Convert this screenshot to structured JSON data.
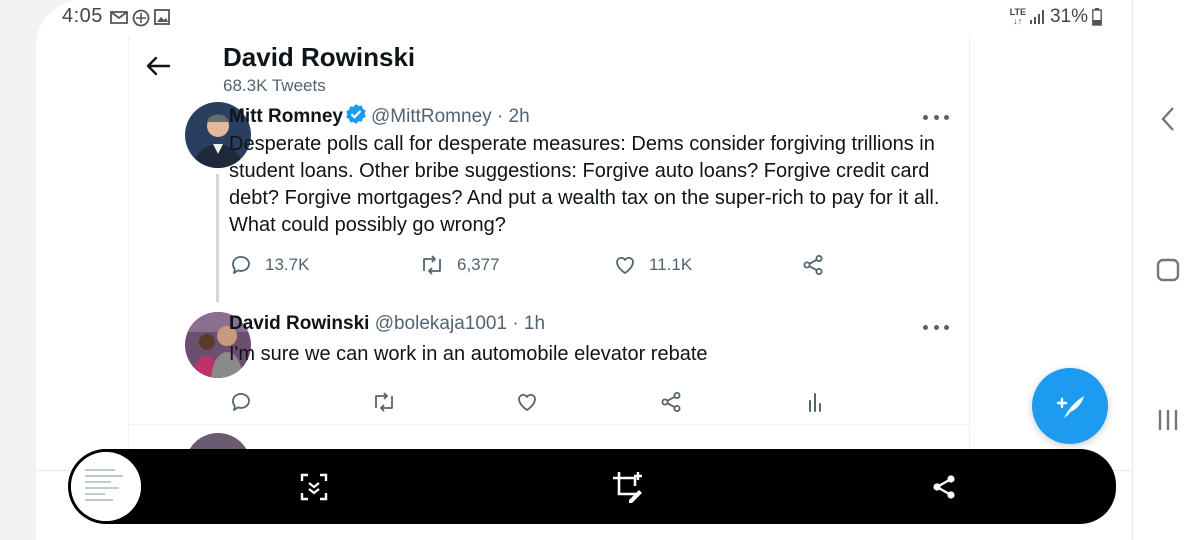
{
  "status_bar": {
    "time": "4:05",
    "network": "LTE",
    "battery": "31%"
  },
  "header": {
    "title": "David Rowinski",
    "subtitle": "68.3K Tweets"
  },
  "tweets": [
    {
      "name": "Mitt Romney",
      "handle": "@MittRomney",
      "time": "· 2h",
      "verified": true,
      "text": "Desperate polls call for desperate measures: Dems consider forgiving trillions in student loans. Other bribe suggestions: Forgive auto loans? Forgive credit card debt? Forgive mortgages? And put a wealth tax on the super-rich to pay for it all. What could possibly go wrong?",
      "replies": "13.7K",
      "retweets": "6,377",
      "likes": "11.1K"
    },
    {
      "name": "David Rowinski",
      "handle": "@bolekaja1001",
      "time": "· 1h",
      "verified": false,
      "text": "I'm sure we can work in an automobile elevator rebate",
      "replies": "",
      "retweets": "",
      "likes": ""
    }
  ],
  "colors": {
    "twitter_blue": "#1d9bf0",
    "text_primary": "#0f1419",
    "text_secondary": "#536471",
    "toolbar_bg": "#000000"
  },
  "icons": {
    "back": "arrow-left-icon",
    "more": "more-dots-icon",
    "reply": "comment-icon",
    "retweet": "retweet-icon",
    "like": "heart-icon",
    "share": "share-icon",
    "analytics": "analytics-icon",
    "compose": "compose-feather-icon",
    "scroll_capture": "scroll-capture-icon",
    "crop_edit": "crop-edit-icon",
    "toolbar_share": "share-icon"
  }
}
